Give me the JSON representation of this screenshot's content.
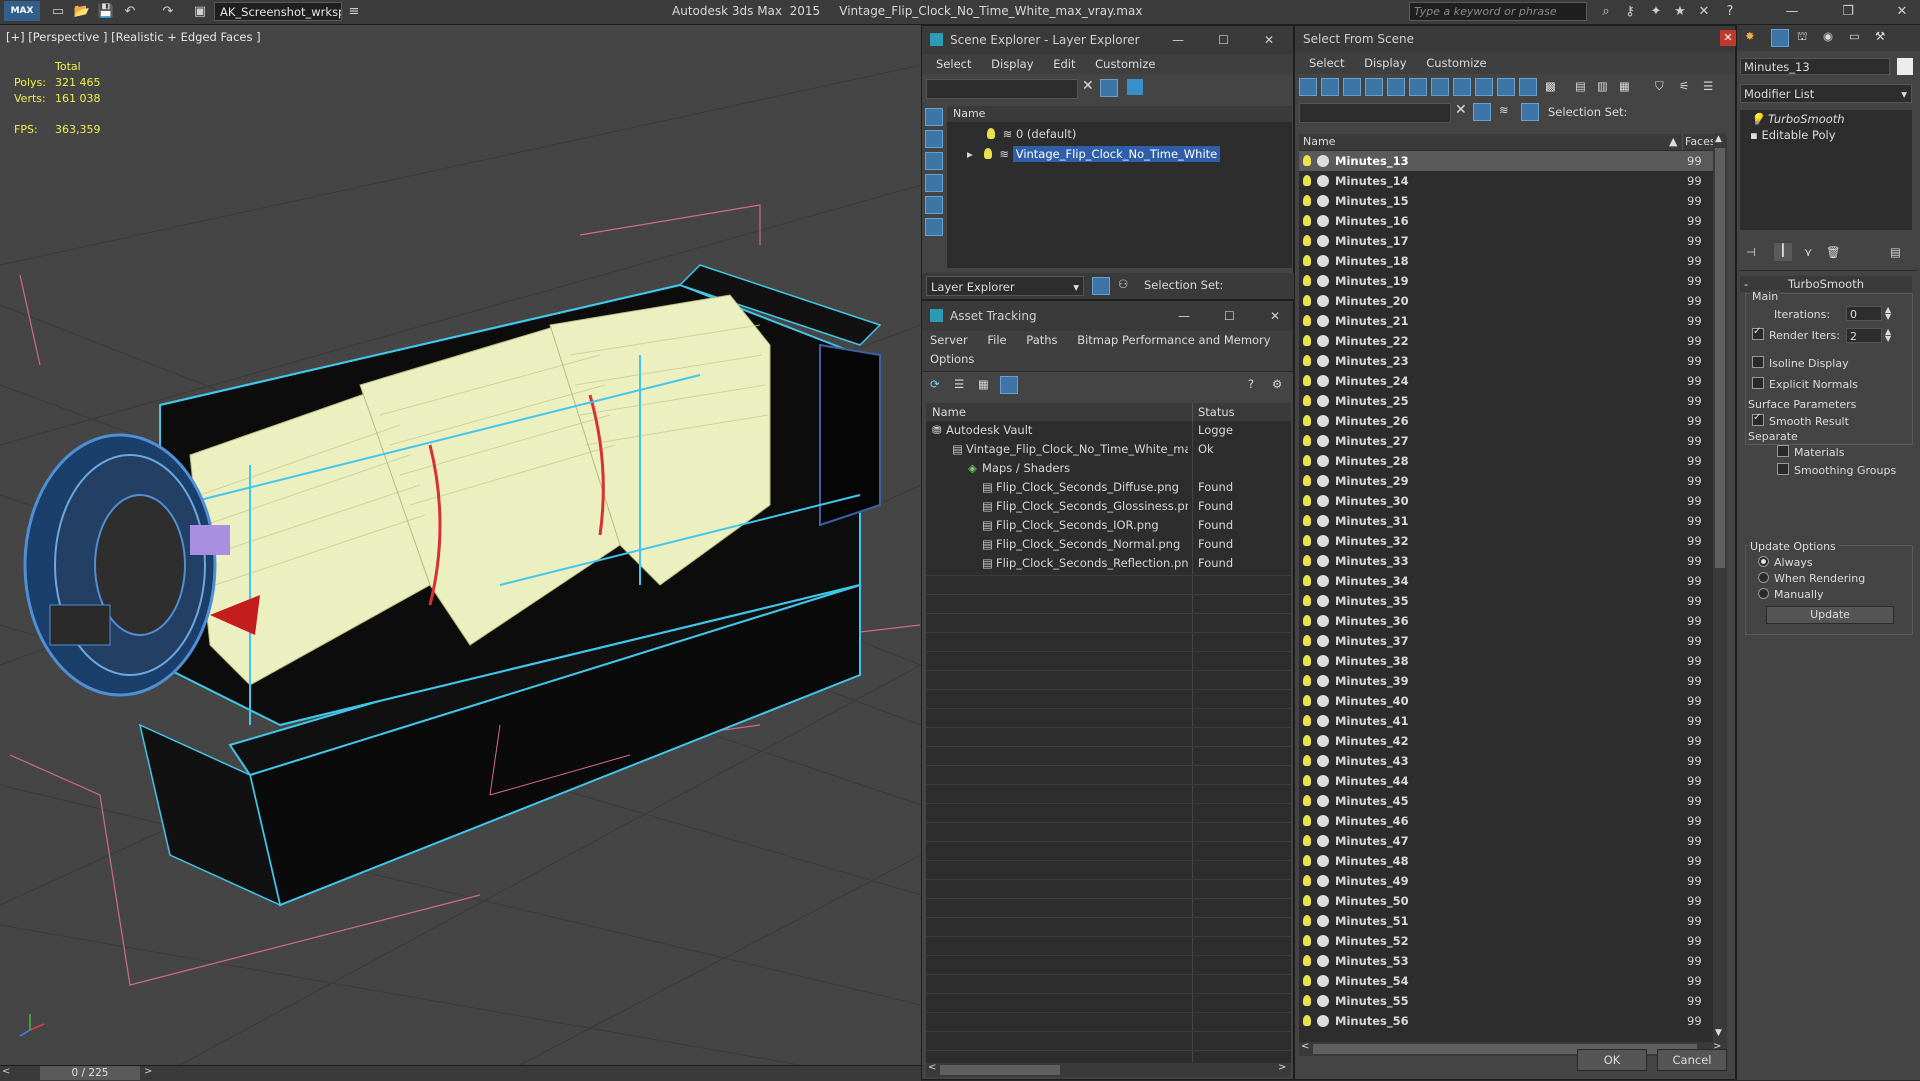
{
  "titlebar": {
    "workspace": "AK_Screenshot_wrksp",
    "app": "Autodesk 3ds Max  2015",
    "file": "Vintage_Flip_Clock_No_Time_White_max_vray.max",
    "search_placeholder": "Type a keyword or phrase"
  },
  "viewport": {
    "label": "[+] [Perspective ] [Realistic + Edged Faces ]",
    "stats": {
      "total_label": "Total",
      "polys_label": "Polys:",
      "polys": "321 465",
      "verts_label": "Verts:",
      "verts": "161 038",
      "fps_label": "FPS:",
      "fps": "363,359"
    }
  },
  "timeline": {
    "frame": "0 / 225"
  },
  "scene_explorer": {
    "title": "Scene Explorer - Layer Explorer",
    "menu": [
      "Select",
      "Display",
      "Edit",
      "Customize"
    ],
    "col_name": "Name",
    "layers": [
      "0 (default)",
      "Vintage_Flip_Clock_No_Time_White"
    ],
    "footer_dropdown": "Layer Explorer",
    "selection_set_label": "Selection Set:"
  },
  "asset_tracking": {
    "title": "Asset Tracking",
    "menu": [
      "Server",
      "File",
      "Paths",
      "Bitmap Performance and Memory",
      "Options"
    ],
    "col_name": "Name",
    "col_status": "Status",
    "rows": [
      {
        "name": "Autodesk Vault",
        "status": "Logge"
      },
      {
        "name": "Vintage_Flip_Clock_No_Time_White_max_vray.m...",
        "status": "Ok"
      },
      {
        "name": "Maps / Shaders",
        "status": ""
      },
      {
        "name": "Flip_Clock_Seconds_Diffuse.png",
        "status": "Found"
      },
      {
        "name": "Flip_Clock_Seconds_Glossiness.png",
        "status": "Found"
      },
      {
        "name": "Flip_Clock_Seconds_IOR.png",
        "status": "Found"
      },
      {
        "name": "Flip_Clock_Seconds_Normal.png",
        "status": "Found"
      },
      {
        "name": "Flip_Clock_Seconds_Reflection.png",
        "status": "Found"
      }
    ]
  },
  "select_from_scene": {
    "title": "Select From Scene",
    "menu": [
      "Select",
      "Display",
      "Customize"
    ],
    "selection_set_label": "Selection Set:",
    "col_name": "Name",
    "col_faces": "Faces",
    "faces_value": "99",
    "items": [
      "Minutes_13",
      "Minutes_14",
      "Minutes_15",
      "Minutes_16",
      "Minutes_17",
      "Minutes_18",
      "Minutes_19",
      "Minutes_20",
      "Minutes_21",
      "Minutes_22",
      "Minutes_23",
      "Minutes_24",
      "Minutes_25",
      "Minutes_26",
      "Minutes_27",
      "Minutes_28",
      "Minutes_29",
      "Minutes_30",
      "Minutes_31",
      "Minutes_32",
      "Minutes_33",
      "Minutes_34",
      "Minutes_35",
      "Minutes_36",
      "Minutes_37",
      "Minutes_38",
      "Minutes_39",
      "Minutes_40",
      "Minutes_41",
      "Minutes_42",
      "Minutes_43",
      "Minutes_44",
      "Minutes_45",
      "Minutes_46",
      "Minutes_47",
      "Minutes_48",
      "Minutes_49",
      "Minutes_50",
      "Minutes_51",
      "Minutes_52",
      "Minutes_53",
      "Minutes_54",
      "Minutes_55",
      "Minutes_56"
    ],
    "ok": "OK",
    "cancel": "Cancel"
  },
  "modify_panel": {
    "object_name": "Minutes_13",
    "modifier_list": "Modifier List",
    "stack": [
      "TurboSmooth",
      "Editable Poly"
    ],
    "rollout_title": "TurboSmooth",
    "main_label": "Main",
    "iterations_label": "Iterations:",
    "iterations": "0",
    "render_iters_label": "Render Iters:",
    "render_iters": "2",
    "isoline": "Isoline Display",
    "explicit_normals": "Explicit Normals",
    "surface_params": "Surface Parameters",
    "smooth_result": "Smooth Result",
    "separate": "Separate",
    "materials": "Materials",
    "smoothing_groups": "Smoothing Groups",
    "update_options": "Update Options",
    "always": "Always",
    "when_rendering": "When Rendering",
    "manually": "Manually",
    "update": "Update"
  }
}
